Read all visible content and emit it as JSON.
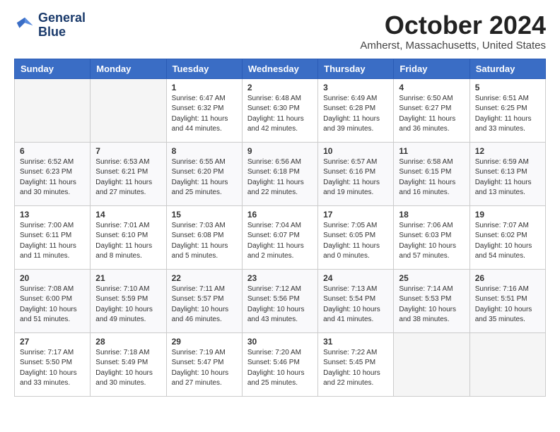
{
  "header": {
    "logo_line1": "General",
    "logo_line2": "Blue",
    "month_title": "October 2024",
    "location": "Amherst, Massachusetts, United States"
  },
  "weekdays": [
    "Sunday",
    "Monday",
    "Tuesday",
    "Wednesday",
    "Thursday",
    "Friday",
    "Saturday"
  ],
  "weeks": [
    [
      {
        "day": "",
        "sunrise": "",
        "sunset": "",
        "daylight": ""
      },
      {
        "day": "",
        "sunrise": "",
        "sunset": "",
        "daylight": ""
      },
      {
        "day": "1",
        "sunrise": "Sunrise: 6:47 AM",
        "sunset": "Sunset: 6:32 PM",
        "daylight": "Daylight: 11 hours and 44 minutes."
      },
      {
        "day": "2",
        "sunrise": "Sunrise: 6:48 AM",
        "sunset": "Sunset: 6:30 PM",
        "daylight": "Daylight: 11 hours and 42 minutes."
      },
      {
        "day": "3",
        "sunrise": "Sunrise: 6:49 AM",
        "sunset": "Sunset: 6:28 PM",
        "daylight": "Daylight: 11 hours and 39 minutes."
      },
      {
        "day": "4",
        "sunrise": "Sunrise: 6:50 AM",
        "sunset": "Sunset: 6:27 PM",
        "daylight": "Daylight: 11 hours and 36 minutes."
      },
      {
        "day": "5",
        "sunrise": "Sunrise: 6:51 AM",
        "sunset": "Sunset: 6:25 PM",
        "daylight": "Daylight: 11 hours and 33 minutes."
      }
    ],
    [
      {
        "day": "6",
        "sunrise": "Sunrise: 6:52 AM",
        "sunset": "Sunset: 6:23 PM",
        "daylight": "Daylight: 11 hours and 30 minutes."
      },
      {
        "day": "7",
        "sunrise": "Sunrise: 6:53 AM",
        "sunset": "Sunset: 6:21 PM",
        "daylight": "Daylight: 11 hours and 27 minutes."
      },
      {
        "day": "8",
        "sunrise": "Sunrise: 6:55 AM",
        "sunset": "Sunset: 6:20 PM",
        "daylight": "Daylight: 11 hours and 25 minutes."
      },
      {
        "day": "9",
        "sunrise": "Sunrise: 6:56 AM",
        "sunset": "Sunset: 6:18 PM",
        "daylight": "Daylight: 11 hours and 22 minutes."
      },
      {
        "day": "10",
        "sunrise": "Sunrise: 6:57 AM",
        "sunset": "Sunset: 6:16 PM",
        "daylight": "Daylight: 11 hours and 19 minutes."
      },
      {
        "day": "11",
        "sunrise": "Sunrise: 6:58 AM",
        "sunset": "Sunset: 6:15 PM",
        "daylight": "Daylight: 11 hours and 16 minutes."
      },
      {
        "day": "12",
        "sunrise": "Sunrise: 6:59 AM",
        "sunset": "Sunset: 6:13 PM",
        "daylight": "Daylight: 11 hours and 13 minutes."
      }
    ],
    [
      {
        "day": "13",
        "sunrise": "Sunrise: 7:00 AM",
        "sunset": "Sunset: 6:11 PM",
        "daylight": "Daylight: 11 hours and 11 minutes."
      },
      {
        "day": "14",
        "sunrise": "Sunrise: 7:01 AM",
        "sunset": "Sunset: 6:10 PM",
        "daylight": "Daylight: 11 hours and 8 minutes."
      },
      {
        "day": "15",
        "sunrise": "Sunrise: 7:03 AM",
        "sunset": "Sunset: 6:08 PM",
        "daylight": "Daylight: 11 hours and 5 minutes."
      },
      {
        "day": "16",
        "sunrise": "Sunrise: 7:04 AM",
        "sunset": "Sunset: 6:07 PM",
        "daylight": "Daylight: 11 hours and 2 minutes."
      },
      {
        "day": "17",
        "sunrise": "Sunrise: 7:05 AM",
        "sunset": "Sunset: 6:05 PM",
        "daylight": "Daylight: 11 hours and 0 minutes."
      },
      {
        "day": "18",
        "sunrise": "Sunrise: 7:06 AM",
        "sunset": "Sunset: 6:03 PM",
        "daylight": "Daylight: 10 hours and 57 minutes."
      },
      {
        "day": "19",
        "sunrise": "Sunrise: 7:07 AM",
        "sunset": "Sunset: 6:02 PM",
        "daylight": "Daylight: 10 hours and 54 minutes."
      }
    ],
    [
      {
        "day": "20",
        "sunrise": "Sunrise: 7:08 AM",
        "sunset": "Sunset: 6:00 PM",
        "daylight": "Daylight: 10 hours and 51 minutes."
      },
      {
        "day": "21",
        "sunrise": "Sunrise: 7:10 AM",
        "sunset": "Sunset: 5:59 PM",
        "daylight": "Daylight: 10 hours and 49 minutes."
      },
      {
        "day": "22",
        "sunrise": "Sunrise: 7:11 AM",
        "sunset": "Sunset: 5:57 PM",
        "daylight": "Daylight: 10 hours and 46 minutes."
      },
      {
        "day": "23",
        "sunrise": "Sunrise: 7:12 AM",
        "sunset": "Sunset: 5:56 PM",
        "daylight": "Daylight: 10 hours and 43 minutes."
      },
      {
        "day": "24",
        "sunrise": "Sunrise: 7:13 AM",
        "sunset": "Sunset: 5:54 PM",
        "daylight": "Daylight: 10 hours and 41 minutes."
      },
      {
        "day": "25",
        "sunrise": "Sunrise: 7:14 AM",
        "sunset": "Sunset: 5:53 PM",
        "daylight": "Daylight: 10 hours and 38 minutes."
      },
      {
        "day": "26",
        "sunrise": "Sunrise: 7:16 AM",
        "sunset": "Sunset: 5:51 PM",
        "daylight": "Daylight: 10 hours and 35 minutes."
      }
    ],
    [
      {
        "day": "27",
        "sunrise": "Sunrise: 7:17 AM",
        "sunset": "Sunset: 5:50 PM",
        "daylight": "Daylight: 10 hours and 33 minutes."
      },
      {
        "day": "28",
        "sunrise": "Sunrise: 7:18 AM",
        "sunset": "Sunset: 5:49 PM",
        "daylight": "Daylight: 10 hours and 30 minutes."
      },
      {
        "day": "29",
        "sunrise": "Sunrise: 7:19 AM",
        "sunset": "Sunset: 5:47 PM",
        "daylight": "Daylight: 10 hours and 27 minutes."
      },
      {
        "day": "30",
        "sunrise": "Sunrise: 7:20 AM",
        "sunset": "Sunset: 5:46 PM",
        "daylight": "Daylight: 10 hours and 25 minutes."
      },
      {
        "day": "31",
        "sunrise": "Sunrise: 7:22 AM",
        "sunset": "Sunset: 5:45 PM",
        "daylight": "Daylight: 10 hours and 22 minutes."
      },
      {
        "day": "",
        "sunrise": "",
        "sunset": "",
        "daylight": ""
      },
      {
        "day": "",
        "sunrise": "",
        "sunset": "",
        "daylight": ""
      }
    ]
  ]
}
